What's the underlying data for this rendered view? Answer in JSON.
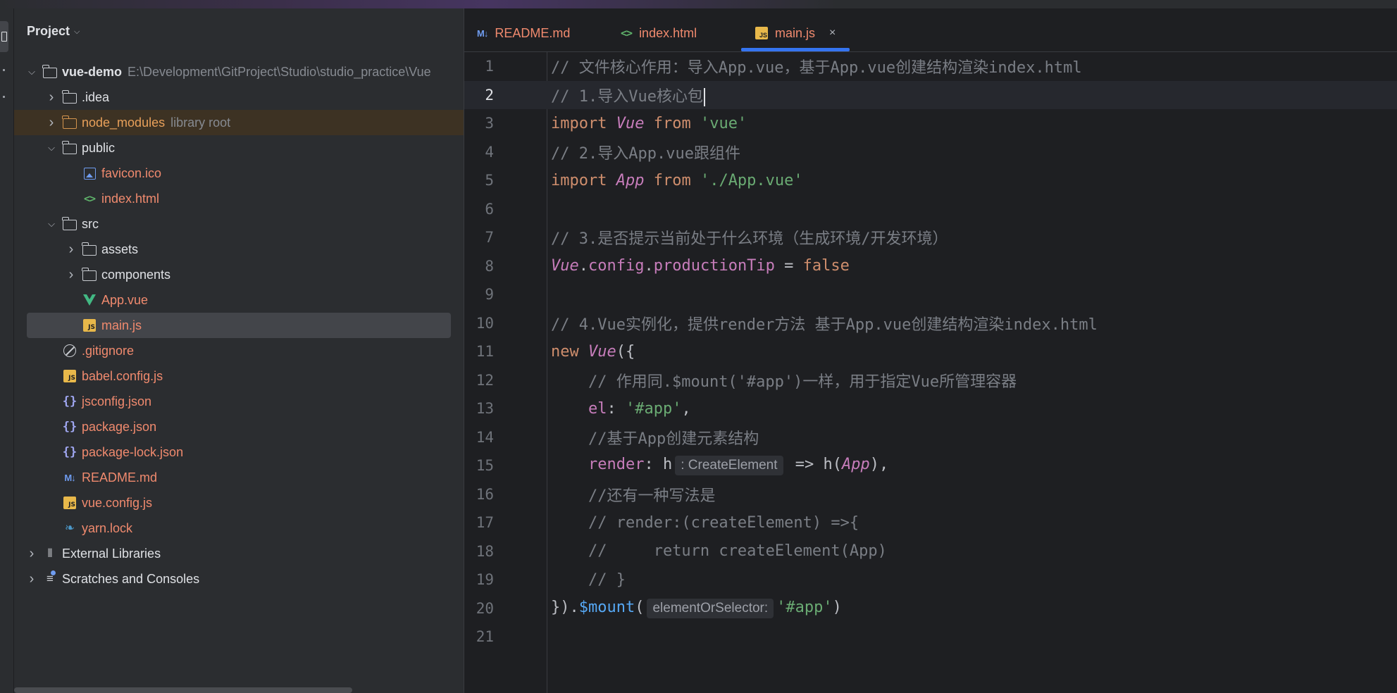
{
  "project_panel": {
    "title": "Project",
    "tree": [
      {
        "label": "vue-demo",
        "hint": "E:\\Development\\GitProject\\Studio\\studio_practice\\Vue",
        "indent": 0,
        "arrow": "v",
        "icon": "folder-icon",
        "style": "bold"
      },
      {
        "label": ".idea",
        "hint": "",
        "indent": 1,
        "arrow": ">",
        "icon": "folder-icon",
        "style": ""
      },
      {
        "label": "node_modules",
        "hint": "library root",
        "indent": 1,
        "arrow": ">",
        "icon": "folder-orange-icon",
        "style": "orange",
        "highlight": true
      },
      {
        "label": "public",
        "hint": "",
        "indent": 1,
        "arrow": "v",
        "icon": "folder-icon",
        "style": ""
      },
      {
        "label": "favicon.ico",
        "hint": "",
        "indent": 2,
        "arrow": "",
        "icon": "image-file-icon",
        "style": "red"
      },
      {
        "label": "index.html",
        "hint": "",
        "indent": 2,
        "arrow": "",
        "icon": "html-file-icon",
        "style": "red"
      },
      {
        "label": "src",
        "hint": "",
        "indent": 1,
        "arrow": "v",
        "icon": "folder-icon",
        "style": ""
      },
      {
        "label": "assets",
        "hint": "",
        "indent": 2,
        "arrow": ">",
        "icon": "folder-icon",
        "style": ""
      },
      {
        "label": "components",
        "hint": "",
        "indent": 2,
        "arrow": ">",
        "icon": "folder-icon",
        "style": ""
      },
      {
        "label": "App.vue",
        "hint": "",
        "indent": 2,
        "arrow": "",
        "icon": "vue-file-icon",
        "style": "red"
      },
      {
        "label": "main.js",
        "hint": "",
        "indent": 2,
        "arrow": "",
        "icon": "js-file-icon",
        "style": "red",
        "selected": true
      },
      {
        "label": ".gitignore",
        "hint": "",
        "indent": 1,
        "arrow": "",
        "icon": "gitignore-icon",
        "style": "red"
      },
      {
        "label": "babel.config.js",
        "hint": "",
        "indent": 1,
        "arrow": "",
        "icon": "js-file-icon",
        "style": "red"
      },
      {
        "label": "jsconfig.json",
        "hint": "",
        "indent": 1,
        "arrow": "",
        "icon": "json-file-icon",
        "style": "red"
      },
      {
        "label": "package.json",
        "hint": "",
        "indent": 1,
        "arrow": "",
        "icon": "json-file-icon",
        "style": "red"
      },
      {
        "label": "package-lock.json",
        "hint": "",
        "indent": 1,
        "arrow": "",
        "icon": "json-file-icon",
        "style": "red"
      },
      {
        "label": "README.md",
        "hint": "",
        "indent": 1,
        "arrow": "",
        "icon": "markdown-file-icon",
        "style": "red"
      },
      {
        "label": "vue.config.js",
        "hint": "",
        "indent": 1,
        "arrow": "",
        "icon": "js-file-icon",
        "style": "red"
      },
      {
        "label": "yarn.lock",
        "hint": "",
        "indent": 1,
        "arrow": "",
        "icon": "yarn-icon",
        "style": "red"
      },
      {
        "label": "External Libraries",
        "hint": "",
        "indent": 0,
        "arrow": ">",
        "icon": "libraries-icon",
        "style": ""
      },
      {
        "label": "Scratches and Consoles",
        "hint": "",
        "indent": 0,
        "arrow": ">",
        "icon": "scratches-icon",
        "style": ""
      }
    ]
  },
  "tabs": [
    {
      "label": "README.md",
      "icon_text": "M↓",
      "icon": "markdown-file-icon"
    },
    {
      "label": "index.html",
      "icon_text": "<>",
      "icon": "html-file-icon"
    },
    {
      "label": "main.js",
      "icon_text": "JS",
      "icon": "js-file-icon",
      "active": true,
      "close": "×"
    }
  ],
  "editor": {
    "current_line": 2,
    "lines": [
      {
        "n": "1",
        "segs": [
          [
            "cm",
            "// 文件核心作用：导入App.vue，基于App.vue创建结构渲染index.html"
          ]
        ]
      },
      {
        "n": "2",
        "segs": [
          [
            "cm",
            "// 1.导入Vue核心包"
          ]
        ],
        "caret": true
      },
      {
        "n": "3",
        "segs": [
          [
            "kw",
            "import "
          ],
          [
            "cls",
            "Vue"
          ],
          [
            "kw",
            " from "
          ],
          [
            "str",
            "'vue'"
          ]
        ]
      },
      {
        "n": "4",
        "segs": [
          [
            "cm",
            "// 2.导入App.vue跟组件"
          ]
        ]
      },
      {
        "n": "5",
        "segs": [
          [
            "kw",
            "import "
          ],
          [
            "cls",
            "App"
          ],
          [
            "kw",
            " from "
          ],
          [
            "str",
            "'./App.vue'"
          ]
        ]
      },
      {
        "n": "6",
        "segs": []
      },
      {
        "n": "7",
        "segs": [
          [
            "cm",
            "// 3.是否提示当前处于什么环境（生成环境/开发环境）"
          ]
        ]
      },
      {
        "n": "8",
        "segs": [
          [
            "cls",
            "Vue"
          ],
          [
            "dflt",
            "."
          ],
          [
            "prop",
            "config"
          ],
          [
            "dflt",
            "."
          ],
          [
            "prop",
            "productionTip"
          ],
          [
            "dflt",
            " = "
          ],
          [
            "kw",
            "false"
          ]
        ]
      },
      {
        "n": "9",
        "segs": []
      },
      {
        "n": "10",
        "segs": [
          [
            "cm",
            "// 4.Vue实例化，提供render方法 基于App.vue创建结构渲染index.html"
          ]
        ]
      },
      {
        "n": "11",
        "segs": [
          [
            "kw",
            "new "
          ],
          [
            "cls",
            "Vue"
          ],
          [
            "dflt",
            "({"
          ]
        ]
      },
      {
        "n": "12",
        "segs": [
          [
            "dflt",
            "    "
          ],
          [
            "cm",
            "// 作用同.$mount('#app')一样，用于指定Vue所管理容器"
          ]
        ]
      },
      {
        "n": "13",
        "segs": [
          [
            "dflt",
            "    "
          ],
          [
            "prop",
            "el"
          ],
          [
            "dflt",
            ": "
          ],
          [
            "str",
            "'#app'"
          ],
          [
            "dflt",
            ","
          ]
        ]
      },
      {
        "n": "14",
        "segs": [
          [
            "dflt",
            "    "
          ],
          [
            "cm",
            "//基于App创建元素结构"
          ]
        ]
      },
      {
        "n": "15",
        "segs": [
          [
            "dflt",
            "    "
          ],
          [
            "prop",
            "render"
          ],
          [
            "dflt",
            ": h"
          ],
          [
            "inlay",
            ": CreateElement"
          ],
          [
            "dflt",
            " => h("
          ],
          [
            "cls",
            "App"
          ],
          [
            "dflt",
            "),"
          ]
        ]
      },
      {
        "n": "16",
        "segs": [
          [
            "dflt",
            "    "
          ],
          [
            "cm",
            "//还有一种写法是"
          ]
        ]
      },
      {
        "n": "17",
        "segs": [
          [
            "dflt",
            "    "
          ],
          [
            "cm",
            "// render:(createElement) =>{"
          ]
        ]
      },
      {
        "n": "18",
        "segs": [
          [
            "dflt",
            "    "
          ],
          [
            "cm",
            "//     return createElement(App)"
          ]
        ]
      },
      {
        "n": "19",
        "segs": [
          [
            "dflt",
            "    "
          ],
          [
            "cm",
            "// }"
          ]
        ]
      },
      {
        "n": "20",
        "segs": [
          [
            "dflt",
            "})."
          ],
          [
            "fn",
            "$mount"
          ],
          [
            "dflt",
            "("
          ],
          [
            "inlay",
            "elementOrSelector:"
          ],
          [
            "str",
            "'#app'"
          ],
          [
            "dflt",
            ")"
          ]
        ]
      },
      {
        "n": "21",
        "segs": []
      }
    ]
  }
}
